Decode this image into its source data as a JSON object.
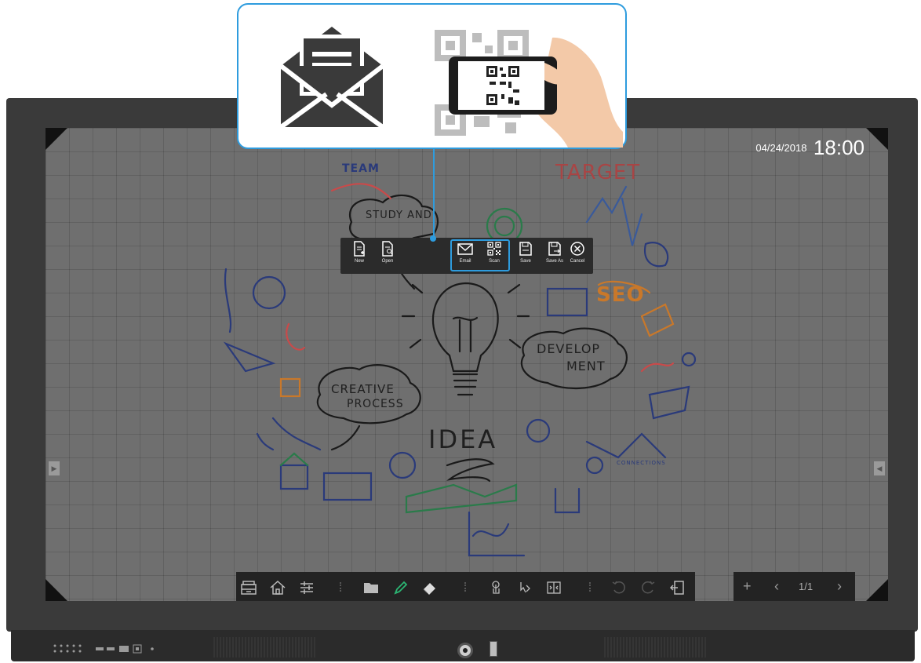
{
  "datetime": {
    "date": "04/24/2018",
    "time": "18:00"
  },
  "whiteboard": {
    "words": {
      "team": "TEAM",
      "target": "TARGET",
      "study": "STUDY AND",
      "seo": "SEO",
      "develop_1": "DEVELOP",
      "develop_2": "MENT",
      "creative_1": "CREATIVE",
      "creative_2": "PROCESS",
      "idea": "IDEA",
      "connections": "CONNECTIONS"
    }
  },
  "file_menu": {
    "items": [
      {
        "label": "New",
        "icon": "new-file-icon"
      },
      {
        "label": "Open",
        "icon": "open-file-icon"
      },
      {
        "label": "Email",
        "icon": "email-icon"
      },
      {
        "label": "Scan",
        "icon": "qr-scan-icon"
      },
      {
        "label": "Save",
        "icon": "save-icon"
      },
      {
        "label": "Save As",
        "icon": "save-as-icon"
      },
      {
        "label": "Cancel",
        "icon": "cancel-icon"
      }
    ],
    "highlight_color": "#2e9cde"
  },
  "toolbar": {
    "icons": [
      "toolbox-icon",
      "home-icon",
      "settings-sliders-icon",
      "folder-icon",
      "pen-icon",
      "eraser-icon",
      "touch-icon",
      "select-icon",
      "split-screen-icon",
      "undo-icon",
      "redo-icon",
      "exit-icon"
    ]
  },
  "pager": {
    "add": "+",
    "prev": "‹",
    "count": "1/1",
    "next": "›"
  },
  "callout": {
    "icons": [
      "envelope-letter-icon",
      "qr-code-phone-scan-icon"
    ],
    "border_color": "#2e9cde"
  }
}
